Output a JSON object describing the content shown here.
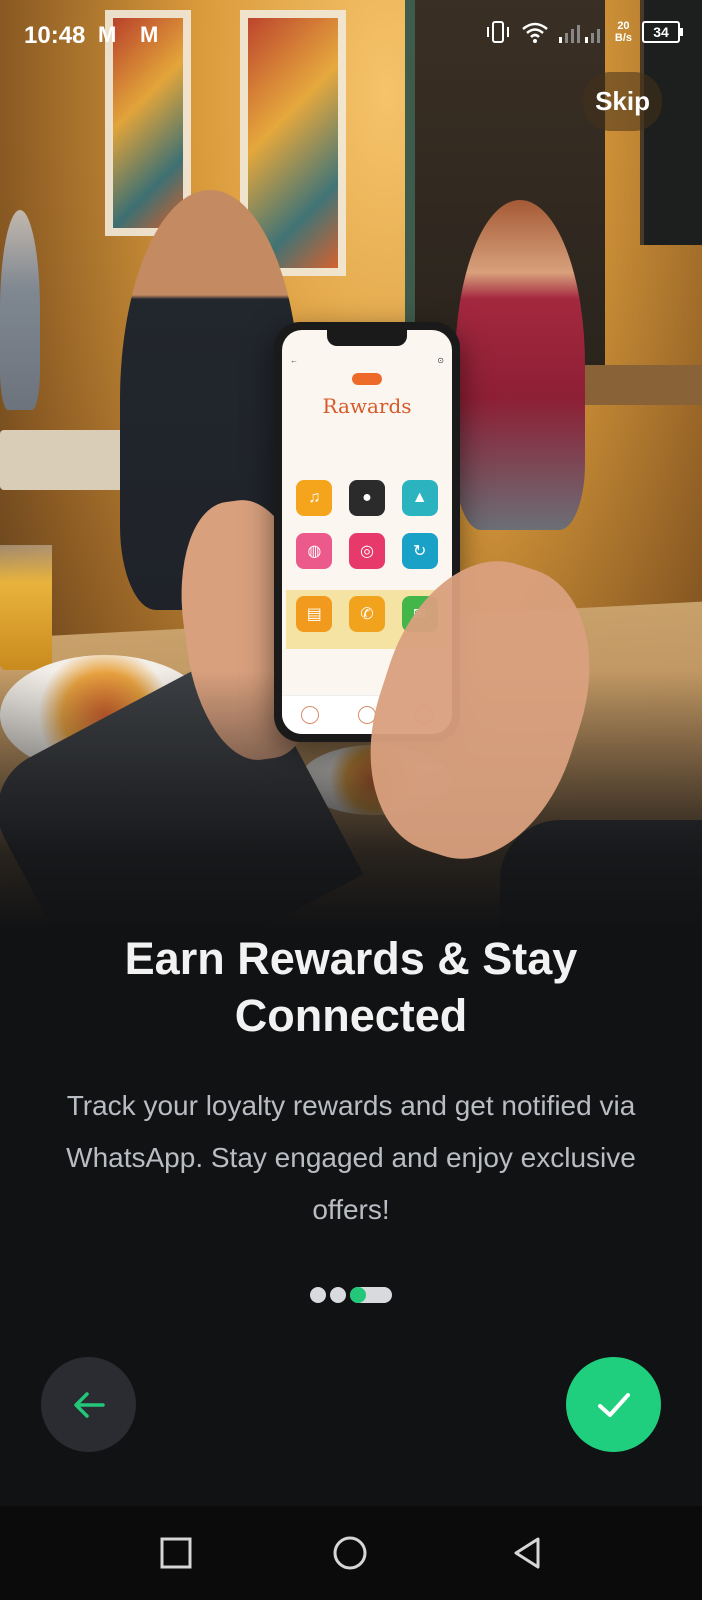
{
  "status_bar": {
    "time": "10:48",
    "mail_icons": [
      "M",
      "M"
    ],
    "net_speed_value": "20",
    "net_speed_unit": "B/s",
    "battery": "34"
  },
  "skip_label": "Skip",
  "phone_mock": {
    "title": "Rawards"
  },
  "onboarding": {
    "title": "Earn Rewards & Stay Connected",
    "description": "Track your loyalty rewards and get notified via WhatsApp. Stay engaged and enjoy exclusive offers!",
    "page_total": 3,
    "page_current": 3
  },
  "colors": {
    "accent": "#1fcf7e",
    "background": "#111214",
    "back_button": "#2a2c31"
  },
  "icons": {
    "back": "arrow-left-icon",
    "done": "check-icon",
    "nav": [
      "square-icon",
      "circle-icon",
      "triangle-back-icon"
    ]
  }
}
